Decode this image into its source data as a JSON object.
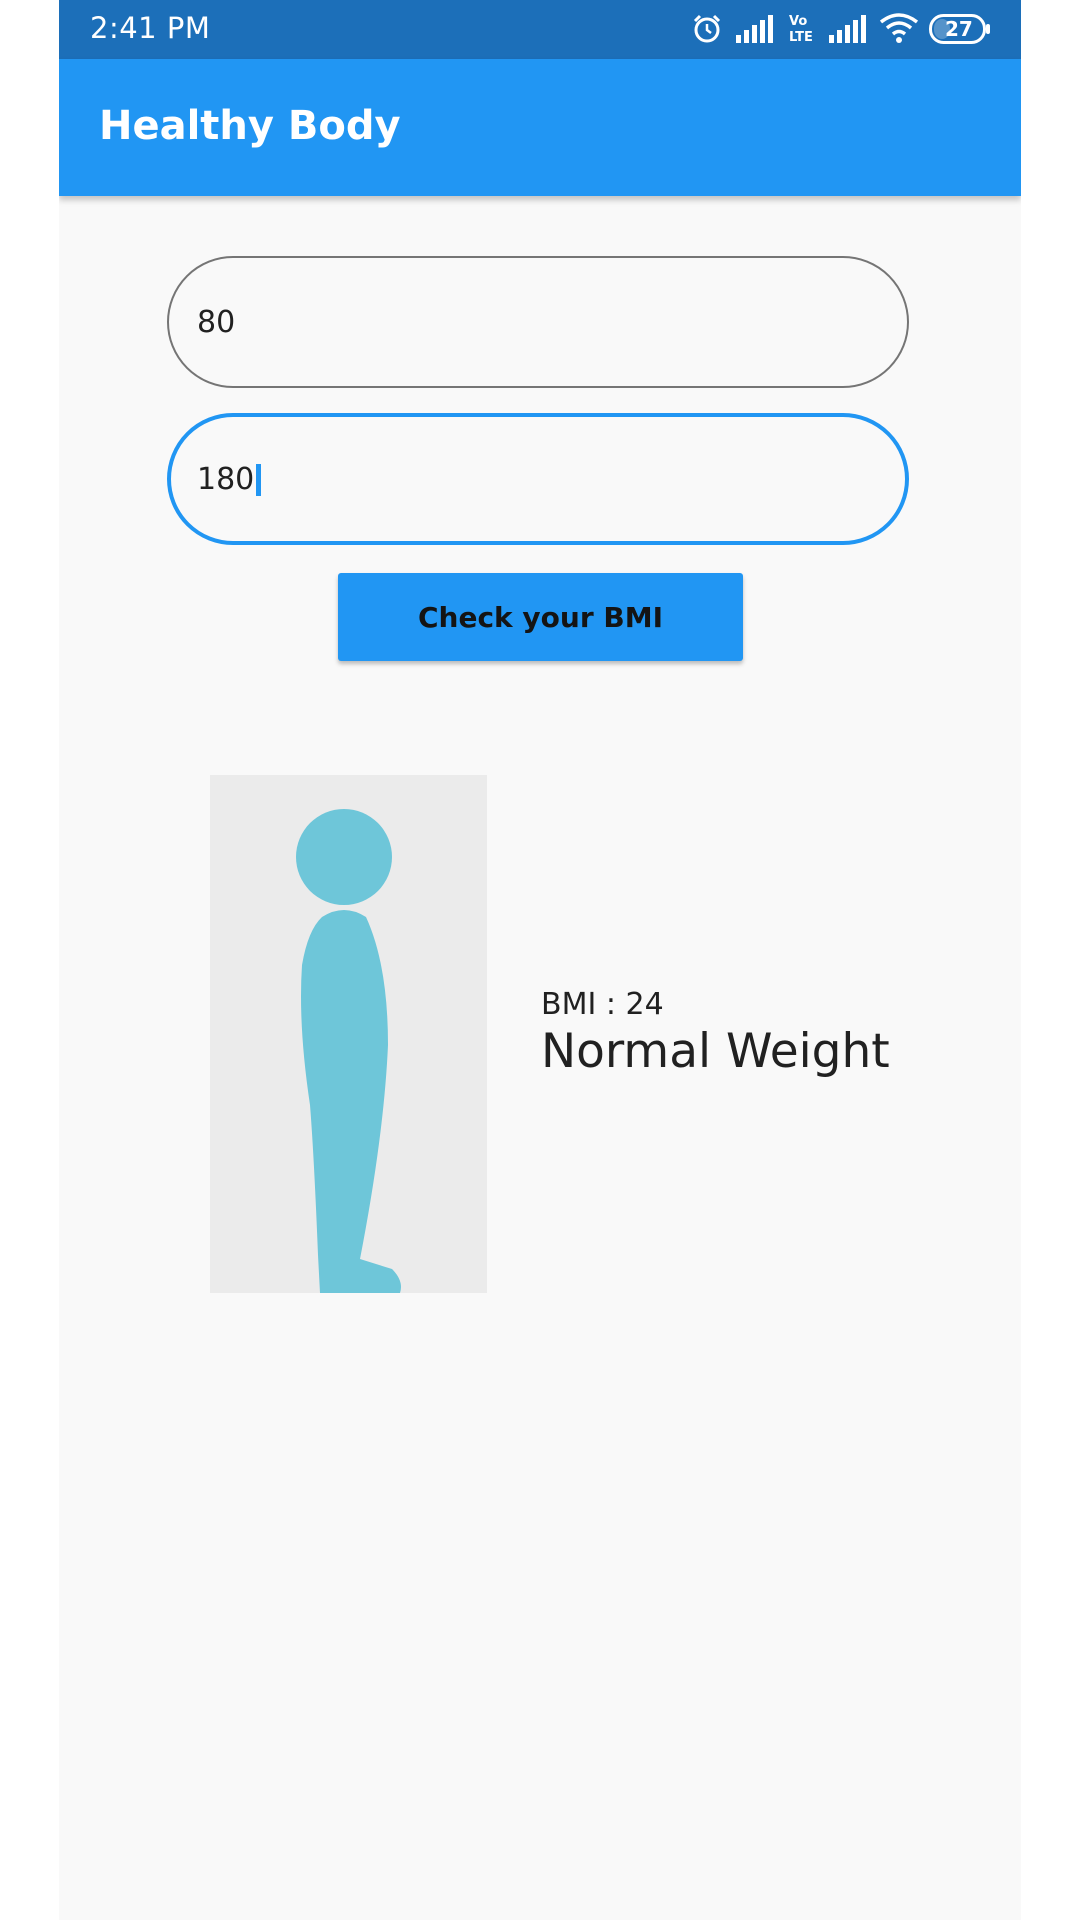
{
  "status_bar": {
    "time": "2:41 PM",
    "battery": "27",
    "icons": [
      "alarm-icon",
      "signal-icon",
      "volte-lte-icon",
      "signal-icon",
      "wifi-icon",
      "battery-icon"
    ],
    "background_color": "#1c6fb9"
  },
  "app_bar": {
    "title": "Healthy Body",
    "color": "#2196f3"
  },
  "form": {
    "weight_value": "80",
    "height_value": "180",
    "button_label": "Check your BMI",
    "accent_color": "#2196f3"
  },
  "result": {
    "bmi_text": "BMI : 24",
    "category": "Normal Weight",
    "figure_icon": "body-silhouette-icon",
    "figure_color": "#6ec6d9"
  }
}
